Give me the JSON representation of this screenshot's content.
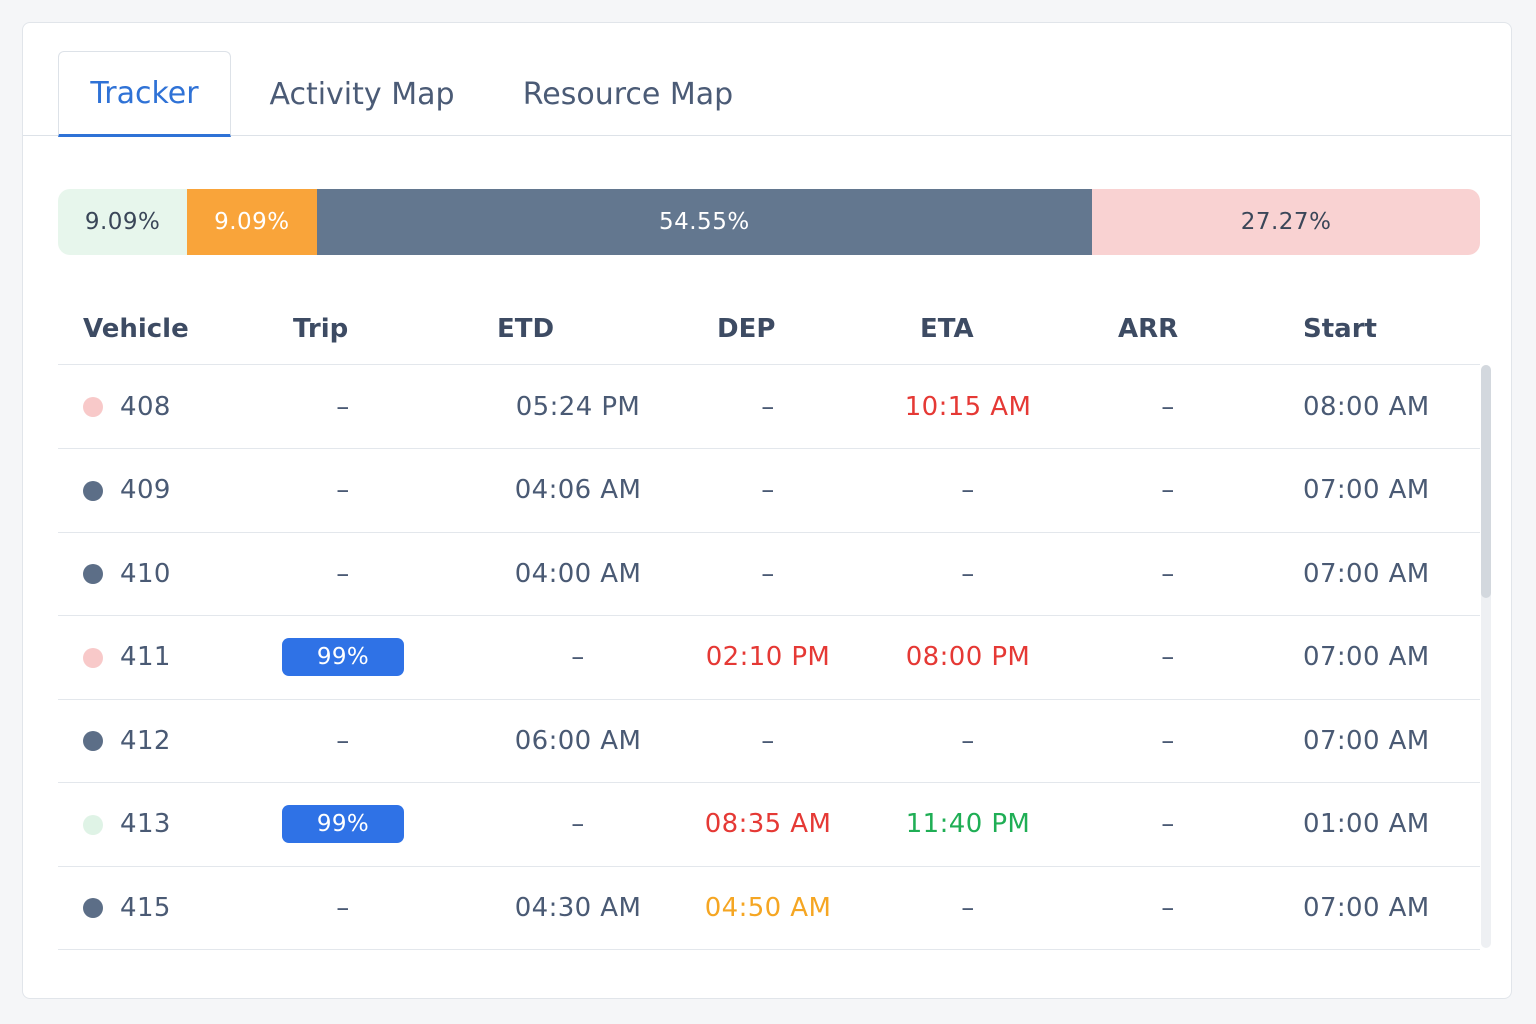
{
  "tabs": [
    {
      "label": "Tracker",
      "active": true
    },
    {
      "label": "Activity Map",
      "active": false
    },
    {
      "label": "Resource Map",
      "active": false
    }
  ],
  "status_bar": [
    {
      "label": "9.09%",
      "value": 9.09,
      "color": "#e7f6ec",
      "text_color": "#3a4658"
    },
    {
      "label": "9.09%",
      "value": 9.09,
      "color": "#f9a43a",
      "text_color": "#ffffff"
    },
    {
      "label": "54.55%",
      "value": 54.55,
      "color": "#63778f",
      "text_color": "#ffffff"
    },
    {
      "label": "27.27%",
      "value": 27.27,
      "color": "#f9d2d2",
      "text_color": "#3a4658"
    }
  ],
  "table": {
    "headers": {
      "vehicle": "Vehicle",
      "trip": "Trip",
      "etd": "ETD",
      "dep": "DEP",
      "eta": "ETA",
      "arr": "ARR",
      "start": "Start"
    },
    "rows": [
      {
        "vehicle": "408",
        "status_color": "#f8c9c9",
        "trip": "–",
        "trip_badge": false,
        "etd": "05:24 PM",
        "etd_color": "#4a5a74",
        "dep": "–",
        "dep_color": "#4a5a74",
        "eta": "10:15 AM",
        "eta_color": "#e53935",
        "arr": "–",
        "start": "08:00 AM"
      },
      {
        "vehicle": "409",
        "status_color": "#5c6e87",
        "trip": "–",
        "trip_badge": false,
        "etd": "04:06 AM",
        "etd_color": "#4a5a74",
        "dep": "–",
        "dep_color": "#4a5a74",
        "eta": "–",
        "eta_color": "#4a5a74",
        "arr": "–",
        "start": "07:00 AM"
      },
      {
        "vehicle": "410",
        "status_color": "#5c6e87",
        "trip": "–",
        "trip_badge": false,
        "etd": "04:00 AM",
        "etd_color": "#4a5a74",
        "dep": "–",
        "dep_color": "#4a5a74",
        "eta": "–",
        "eta_color": "#4a5a74",
        "arr": "–",
        "start": "07:00 AM"
      },
      {
        "vehicle": "411",
        "status_color": "#f8c9c9",
        "trip": "99%",
        "trip_badge": true,
        "etd": "–",
        "etd_color": "#4a5a74",
        "dep": "02:10 PM",
        "dep_color": "#e53935",
        "eta": "08:00 PM",
        "eta_color": "#e53935",
        "arr": "–",
        "start": "07:00 AM"
      },
      {
        "vehicle": "412",
        "status_color": "#5c6e87",
        "trip": "–",
        "trip_badge": false,
        "etd": "06:00 AM",
        "etd_color": "#4a5a74",
        "dep": "–",
        "dep_color": "#4a5a74",
        "eta": "–",
        "eta_color": "#4a5a74",
        "arr": "–",
        "start": "07:00 AM"
      },
      {
        "vehicle": "413",
        "status_color": "#dff3e6",
        "trip": "99%",
        "trip_badge": true,
        "etd": "–",
        "etd_color": "#4a5a74",
        "dep": "08:35 AM",
        "dep_color": "#e53935",
        "eta": "11:40 PM",
        "eta_color": "#1fae55",
        "arr": "–",
        "start": "01:00 AM"
      },
      {
        "vehicle": "415",
        "status_color": "#5c6e87",
        "trip": "–",
        "trip_badge": false,
        "etd": "04:30 AM",
        "etd_color": "#4a5a74",
        "dep": "04:50 AM",
        "dep_color": "#f5a623",
        "eta": "–",
        "eta_color": "#4a5a74",
        "arr": "–",
        "start": "07:00 AM"
      }
    ]
  },
  "scrollbar": {
    "position": 0,
    "visible_fraction": 0.4
  }
}
